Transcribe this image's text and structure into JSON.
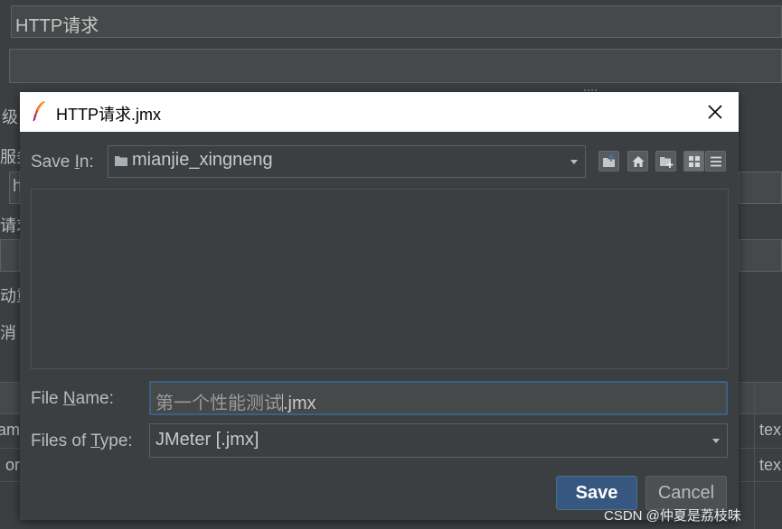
{
  "background_window": {
    "name_value": "HTTP请求",
    "left_fragments": [
      "级",
      "服务",
      "h",
      "请求",
      "动重",
      "消"
    ],
    "table_left_cells": [
      "am",
      "or"
    ],
    "table_right_cells": [
      "tex",
      "tex"
    ]
  },
  "dialog": {
    "title": "HTTP请求.jmx",
    "save_in": {
      "label_pre": "Save ",
      "label_mnemonic": "I",
      "label_post": "n:",
      "folder": "mianjie_xingneng"
    },
    "file_name": {
      "label_pre": "File ",
      "label_mnemonic": "N",
      "label_post": "ame:",
      "value_before_caret": "第一个性能测试",
      "value_after_caret": ".jmx"
    },
    "files_of_type": {
      "label_pre": "Files of ",
      "label_mnemonic": "T",
      "label_post": "ype:",
      "value": "JMeter [.jmx]"
    },
    "buttons": {
      "save": "Save",
      "cancel": "Cancel"
    }
  },
  "watermark": "CSDN @仲夏是荔枝味",
  "colors": {
    "background": "#3c3f41",
    "titlebar": "#ffffff",
    "save_button": "#365880",
    "focus_border": "#3d6185"
  },
  "icons": [
    "feather-icon",
    "close-icon",
    "folder-icon",
    "chevron-down-icon",
    "up-folder-icon",
    "home-icon",
    "new-folder-icon",
    "list-view-icon",
    "details-view-icon"
  ]
}
